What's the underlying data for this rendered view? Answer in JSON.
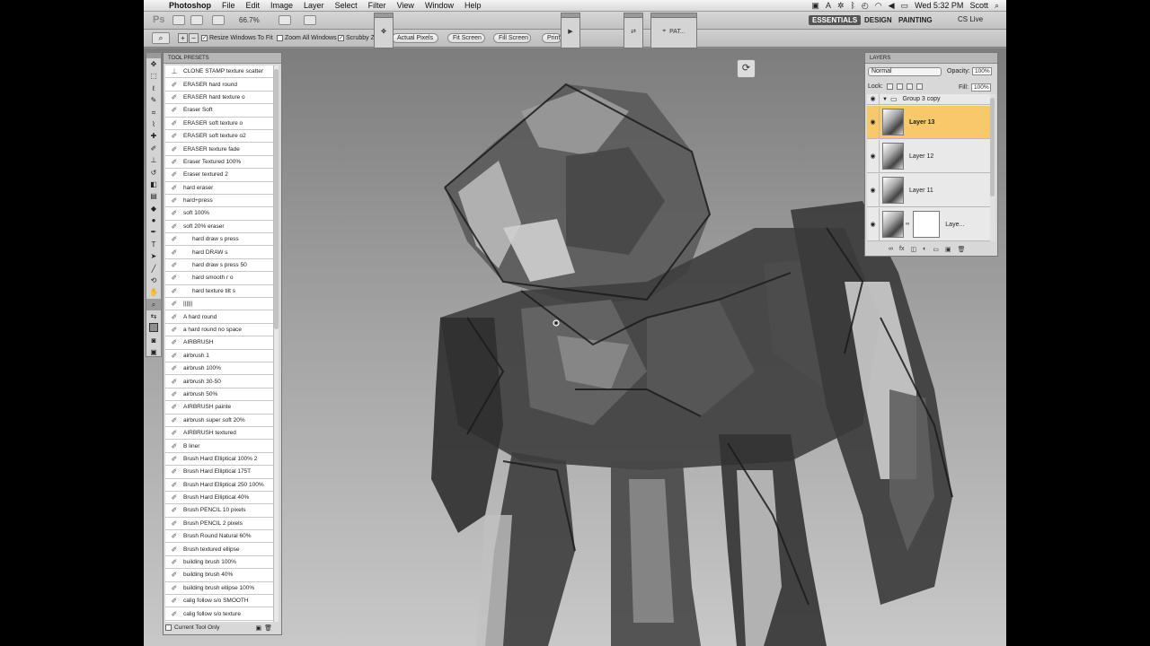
{
  "menubar": {
    "app": "Photoshop",
    "items": [
      "File",
      "Edit",
      "Image",
      "Layer",
      "Select",
      "Filter",
      "View",
      "Window",
      "Help"
    ],
    "clock": "Wed 5:32 PM",
    "user": "Scott"
  },
  "appbar": {
    "zoom": "66.7%",
    "workspaces": [
      "ESSENTIALS",
      "DESIGN",
      "PAINTING"
    ],
    "cslive": "CS Live"
  },
  "options": {
    "resize_windows": "Resize Windows To Fit",
    "zoom_all": "Zoom All Windows",
    "scrubby": "Scrubby Z",
    "buttons": [
      "Actual Pixels",
      "Fit Screen",
      "Fill Screen",
      "Print"
    ]
  },
  "docks": {
    "pat_label": "PAT..."
  },
  "presets": {
    "title": "TOOL PRESETS",
    "items": [
      "CLONE STAMP texture scatter",
      "ERASER hard round",
      "ERASER hard texture o",
      "Eraser Soft",
      "ERASER soft texture o",
      "ERASER soft texture o2",
      "ERASER texture fade",
      "Eraser Textured 100%",
      "Eraser textured 2",
      "hard eraser",
      "hard+press",
      "soft 100%",
      "soft 20% eraser",
      "hard draw s press",
      "hard DRAW s",
      "hard draw s press 50",
      "hard smooth r o",
      "hard texture tilt s",
      "||||||",
      "A hard round",
      "a hard round no space",
      "AIRBRUSH",
      "airbrush 1",
      "airbrush 100%",
      "airbrush 30-50",
      "airbrush 50%",
      "AIRBRUSH painte",
      "airbrush super soft 20%",
      "AIRBRUSH textured",
      "B liner",
      "Brush Hard Elliptical 100% 2",
      "Brush Hard Elliptical 175T",
      "Brush Hard Elliptical 250 100%",
      "Brush Hard Elliptical 40%",
      "Brush PENCIL 10 pixels",
      "Brush PENCIL 2 pixels",
      "Brush Round Natural 60%",
      "Brush textured ellipse",
      "building brush 100%",
      "building brush 40%",
      "building brush ellipse 100%",
      "calig follow s/o SMOOTH",
      "calig follow s/o texture"
    ],
    "footer": "Current Tool Only"
  },
  "layers": {
    "title": "LAYERS",
    "blend_mode": "Normal",
    "opacity_label": "Opacity:",
    "opacity": "100%",
    "lock_label": "Lock:",
    "fill_label": "Fill:",
    "fill": "100%",
    "group": "Group 3 copy",
    "rows": [
      "Layer 13",
      "Layer 12",
      "Layer 11",
      "Laye..."
    ]
  },
  "colors": {
    "selected_layer": "#f7c96b",
    "workspace_active": "#555555"
  }
}
